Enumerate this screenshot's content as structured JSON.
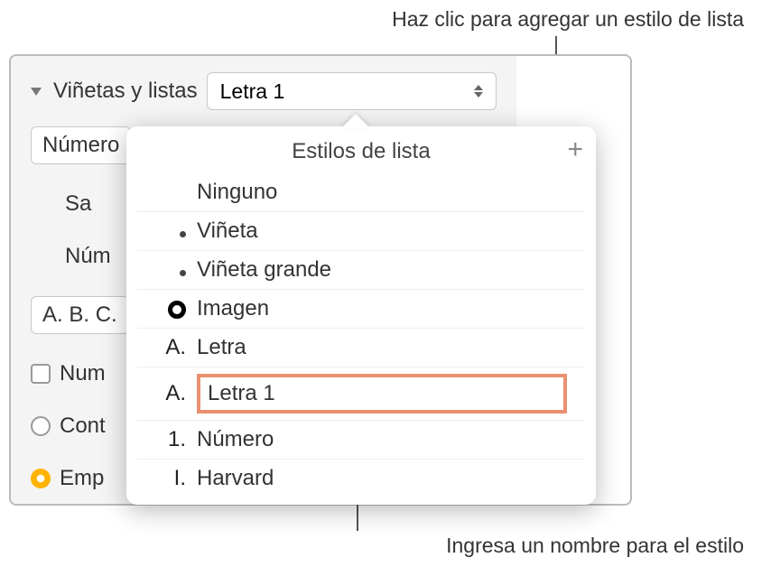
{
  "callouts": {
    "top": "Haz clic para agregar un estilo de lista",
    "bottom": "Ingresa un nombre para el estilo"
  },
  "section": {
    "label": "Viñetas y listas",
    "selected_style": "Letra 1"
  },
  "truncated": {
    "row1": "Número",
    "row2": "Sa",
    "row3": "Núm",
    "row4": "A. B. C.",
    "row5": "Num",
    "row6": "Cont",
    "row7": "Emp"
  },
  "popover": {
    "title": "Estilos de lista",
    "add_glyph": "+",
    "items": [
      {
        "marker": "",
        "marker_type": "none",
        "label": "Ninguno"
      },
      {
        "marker": "",
        "marker_type": "bullet",
        "label": "Viñeta"
      },
      {
        "marker": "",
        "marker_type": "bullet",
        "label": "Viñeta grande"
      },
      {
        "marker": "",
        "marker_type": "image",
        "label": "Imagen"
      },
      {
        "marker": "A.",
        "marker_type": "text",
        "label": "Letra"
      },
      {
        "marker": "A.",
        "marker_type": "text",
        "label": "Letra 1",
        "editing": true
      },
      {
        "marker": "1.",
        "marker_type": "text",
        "label": "Número"
      },
      {
        "marker": "I.",
        "marker_type": "text",
        "label": "Harvard"
      }
    ]
  }
}
